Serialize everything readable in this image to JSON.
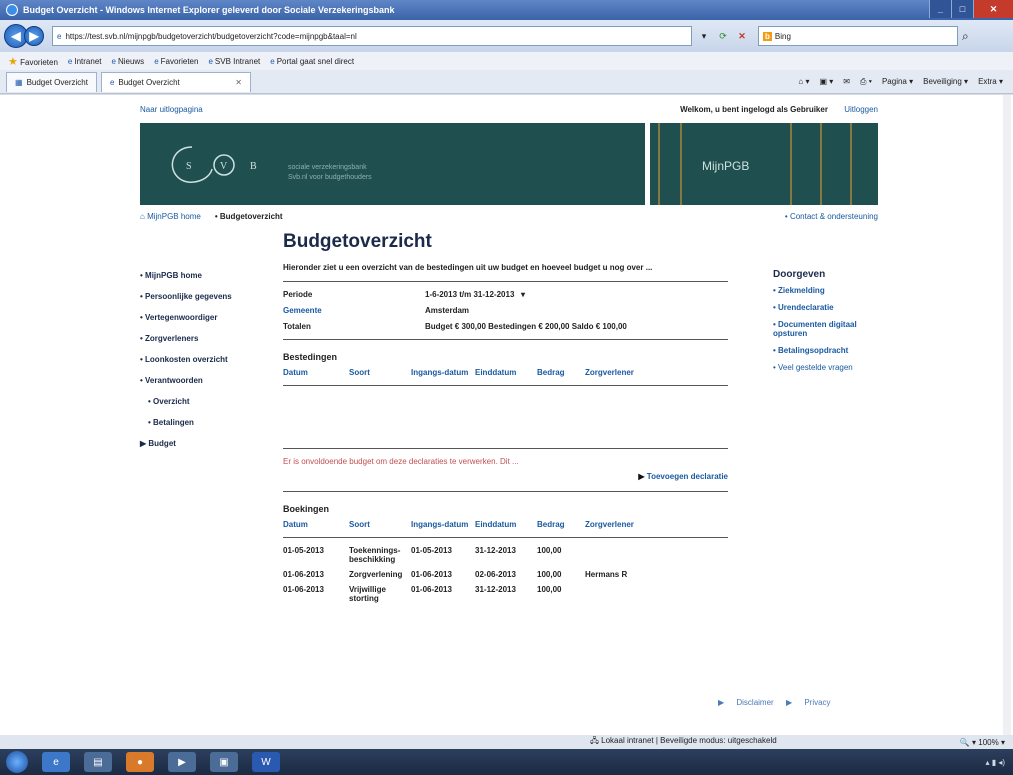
{
  "window": {
    "title": "Budget Overzicht - Windows Internet Explorer geleverd door Sociale Verzekeringsbank"
  },
  "address": {
    "url": "https://test.svb.nl/mijnpgb/budgetoverzicht/budgetoverzicht?code=mijnpgb&taal=nl",
    "search_engine": "Bing"
  },
  "favorites": {
    "label": "Favorieten",
    "links": [
      "Intranet",
      "Nieuws",
      "Favorieten",
      "SVB Intranet",
      "Portal gaat snel direct"
    ]
  },
  "tabs": {
    "active": "Budget Overzicht",
    "group": "Budget Overzicht"
  },
  "commandbar": [
    "Pagina",
    "Beveiliging",
    "Extra"
  ],
  "page": {
    "top_left": "Naar uitlogpagina",
    "top_right_user": "Welkom, u bent ingelogd als Gebruiker",
    "logout": "Uitloggen",
    "banner_tagline_1": "sociale verzekeringsbank",
    "banner_tagline_2": "Svb.nl voor budgethouders",
    "banner_right": "MijnPGB",
    "crumb_home": "MijnPGB home",
    "crumb_current": "Budgetoverzicht",
    "contact": "Contact & ondersteuning",
    "title": "Budgetoverzicht",
    "intro": "Hieronder ziet u een overzicht van de bestedingen uit uw budget en hoeveel budget u nog over ...",
    "periode_label": "Periode",
    "periode_value": "1-6-2013 t/m 31-12-2013",
    "gemeente_label": "Gemeente",
    "gemeente_value": "Amsterdam",
    "totalen_label": "Totalen",
    "totalen_value": "Budget € 300,00  Bestedingen € 200,00  Saldo € 100,00",
    "bestedingen_title": "Bestedingen",
    "columns": [
      "Datum",
      "Soort",
      "Ingangs-datum",
      "Einddatum",
      "Bedrag",
      "Zorgverlener"
    ],
    "warning": "Er is onvoldoende budget om deze declaraties te verwerken. Dit ...",
    "declaratie_link": "Toevoegen declaratie",
    "boekingen_title": "Boekingen",
    "boekingen_rows": [
      {
        "datum": "01-05-2013",
        "soort": "Toekennings-beschikking",
        "ingang": "01-05-2013",
        "eind": "31-12-2013",
        "bedrag": "100,00",
        "zorg": ""
      },
      {
        "datum": "01-06-2013",
        "soort": "Zorgverlening",
        "ingang": "01-06-2013",
        "eind": "02-06-2013",
        "bedrag": "100,00",
        "zorg": "Hermans R"
      },
      {
        "datum": "01-06-2013",
        "soort": "Vrijwillige storting",
        "ingang": "01-06-2013",
        "eind": "31-12-2013",
        "bedrag": "100,00",
        "zorg": ""
      }
    ],
    "footer_links": [
      "Disclaimer",
      "Privacy"
    ]
  },
  "leftnav": [
    {
      "label": "MijnPGB home",
      "sub": false
    },
    {
      "label": "Persoonlijke gegevens",
      "sub": false
    },
    {
      "label": "Vertegenwoordiger",
      "sub": false
    },
    {
      "label": "Zorgverleners",
      "sub": false
    },
    {
      "label": "Loonkosten overzicht",
      "sub": false
    },
    {
      "label": "Verantwoorden",
      "sub": false
    },
    {
      "label": "Overzicht",
      "sub": true
    },
    {
      "label": "Betalingen",
      "sub": true
    },
    {
      "label": "Budget",
      "sub": false,
      "selected": true
    }
  ],
  "rightcol": {
    "title": "Doorgeven",
    "items": [
      "Ziekmelding",
      "Urendeclaratie",
      "Documenten digitaal opsturen",
      "Betalingsopdracht"
    ],
    "faq": "Veel gestelde vragen"
  },
  "status": {
    "zone": "Lokaal intranet | Beveiligde modus: uitgeschakeld",
    "zoom": "100%"
  }
}
